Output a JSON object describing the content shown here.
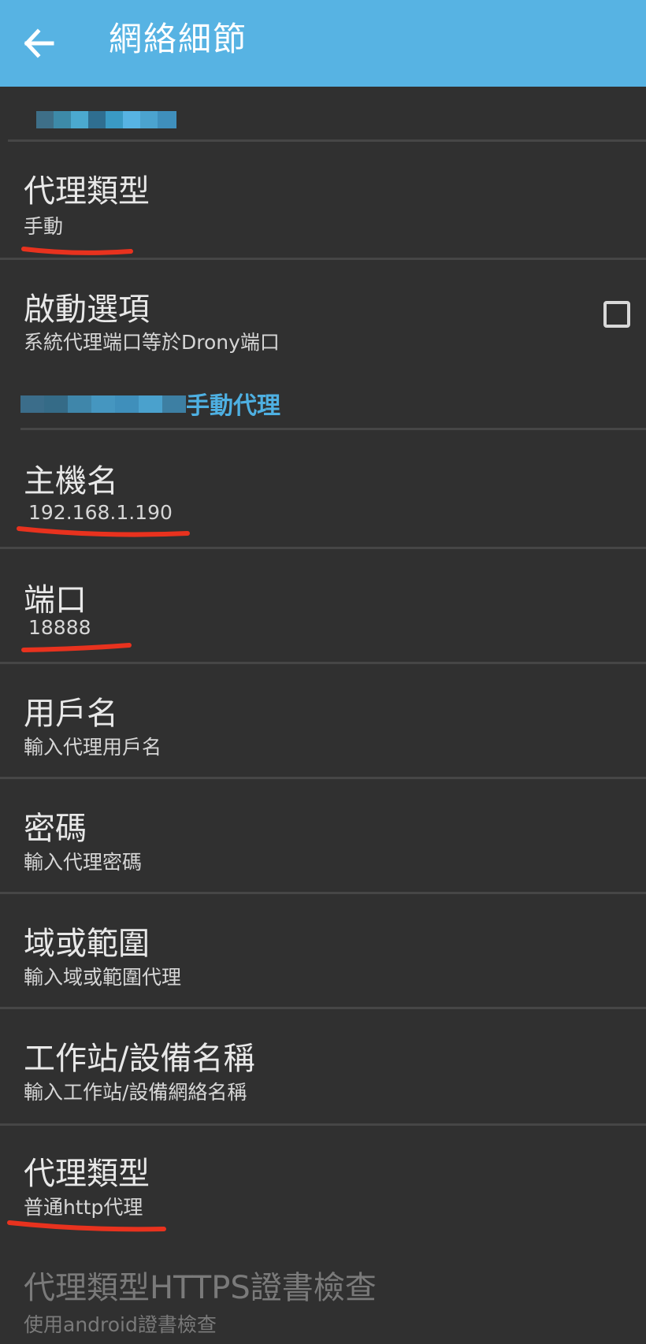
{
  "appbar": {
    "title": "網絡細節",
    "back_icon": "arrow-left-icon",
    "background_color": "#57b3e3"
  },
  "network_name_redacted": true,
  "items": [
    {
      "title": "代理類型",
      "summary": "手動"
    },
    {
      "title": "啟動選項",
      "summary": "系統代理端口等於Drony端口",
      "checkbox_checked": false
    }
  ],
  "category": {
    "label": "手動代理",
    "color": "#4eb0e2"
  },
  "proxy_items": [
    {
      "title": "主機名",
      "summary": "192.168.1.190"
    },
    {
      "title": "端口",
      "summary": "18888"
    },
    {
      "title": "用戶名",
      "summary": "輸入代理用戶名"
    },
    {
      "title": "密碼",
      "summary": "輸入代理密碼"
    },
    {
      "title": "域或範圍",
      "summary": "輸入域或範圍代理"
    },
    {
      "title": "工作站/設備名稱",
      "summary": "輸入工作站/設備網絡名稱"
    },
    {
      "title": "代理類型",
      "summary": "普通http代理"
    },
    {
      "title": "代理類型HTTPS證書檢查",
      "summary": "使用android證書檢查",
      "disabled": true
    }
  ],
  "annotation_color": "#e8321e"
}
